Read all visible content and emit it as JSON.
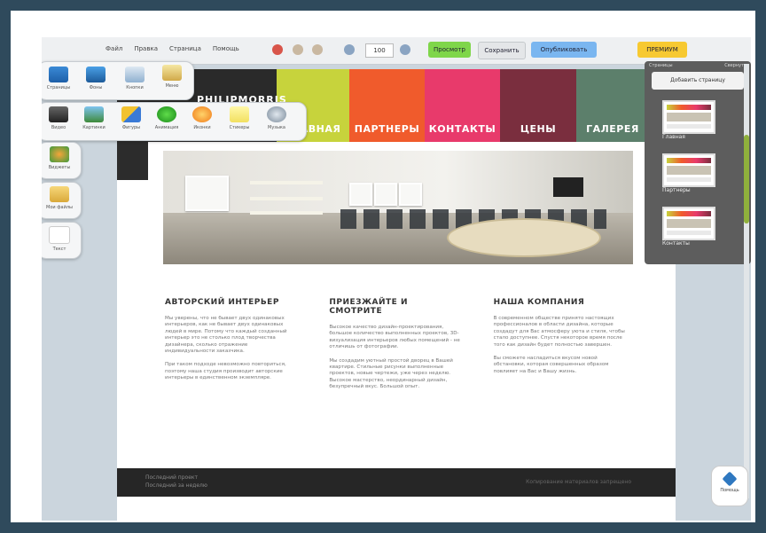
{
  "menu": [
    "Файл",
    "Правка",
    "Страница",
    "Помощь"
  ],
  "zoom": "100",
  "toolbar": {
    "preview": "Просмотр",
    "save": "Сохранить",
    "publish": "Опубликовать",
    "premium": "ПРЕМИУМ"
  },
  "colors": {
    "preview_bg": "#7fd64a",
    "save_bg": "#e4e6e8",
    "publish_bg": "#7ab6f0",
    "premium_bg": "#f7c931",
    "nav": [
      "#2a2a2a",
      "#c7d33c",
      "#f05b2c",
      "#e83a6b",
      "#7a2e3e",
      "#5c7f6b"
    ]
  },
  "tool_panel_1": [
    "Страницы",
    "Фоны",
    "Кнопки",
    "Меню"
  ],
  "tool_panel_2": [
    "Видео",
    "Картинки",
    "Фигуры",
    "Анимация",
    "Иконки",
    "Стикеры",
    "Музыка"
  ],
  "tool_side": [
    "Виджеты",
    "Мои файлы",
    "Текст"
  ],
  "site": {
    "logo": "PHILIPMORRIS",
    "nav": [
      "ГЛАВНАЯ",
      "ПАРТНЕРЫ",
      "КОНТАКТЫ",
      "ЦЕНЫ",
      "ГАЛЕРЕЯ"
    ],
    "columns": [
      {
        "title": "АВТОРСКИЙ ИНТЕРЬЕР",
        "p1": "Мы уверены, что не бывает двух одинаковых интерьеров, как не бывает двух одинаковых людей в мире. Потому что каждый созданный интерьер это не столько плод творчества дизайнера, сколько отражение индивидуальности заказчика.",
        "p2": "При таком подходе невозможно повториться, поэтому наша студия производит авторские интерьеры в единственном экземпляре."
      },
      {
        "title": "ПРИЕЗЖАЙТЕ И СМОТРИТЕ",
        "p1": "Высокое качество дизайн-проектирования, большое количество выполненных проектов, 3D-визуализация интерьеров любых помещений - не отличишь от фотографии.",
        "p2": "Мы создадим уютный простой дворец в Вашей квартире. Стильные рисунки выполненные проектов, новые чертежи, уже через неделю. Высокое мастерство, неординарный дизайн, безупречный вкус. Большой опыт."
      },
      {
        "title": "НАША КОМПАНИЯ",
        "p1": "В современном обществе принято настоящих профессионалов в области дизайна, которые создадут для Вас атмосферу уюта и стиля, чтобы стало доступнее. Спустя некоторое время после того как дизайн будет полностью завершен.",
        "p2": "Вы сможете насладиться вкусом новой обстановки, которая совершенных образом повлияет на Вас и Вашу жизнь."
      }
    ],
    "footer_left_1": "Последний проект",
    "footer_left_2": "Последний за неделю",
    "footer_right": "Копирование материалов запрещено"
  },
  "pages_panel": {
    "head_left": "Страницы",
    "head_right": "Свернуть",
    "add_page": "Добавить страницу",
    "items": [
      "Главная",
      "Партнеры",
      "Контакты"
    ]
  },
  "help": "Помощь"
}
